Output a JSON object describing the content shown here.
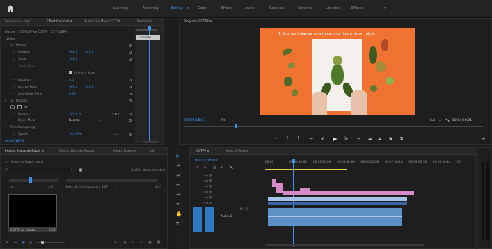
{
  "workspace_tabs": [
    "Learning",
    "Assembly",
    "Editing",
    "Color",
    "Effects",
    "Audio",
    "Graphics",
    "Libraries",
    "Libraries",
    "Effects"
  ],
  "workspace_active": "Editing",
  "source_panel": {
    "tabs": [
      "Source: (no clips)",
      "Effect Controls ≡",
      "Audio Clip Mixer: CCTPP",
      "Metadata"
    ],
    "active_tab": "Effect Controls ≡",
    "clip_label": "Master * CCTSUBPR ▸ CCTPP * CCTSUBPR",
    "section_video": "Video",
    "motion": "Motion",
    "position": "Position",
    "position_x": "960.0",
    "position_y": "540.0",
    "scale": "Scale",
    "scale_val": "100.0",
    "scale_width": "Scale Width",
    "uniform_scale": "Uniform Scale",
    "rotation": "Rotation",
    "rotation_val": "0.0",
    "anchor_point": "Anchor Point",
    "anchor_x": "960.0",
    "anchor_y": "540.0",
    "anti_flicker": "Anti-flicker Filter",
    "anti_flicker_val": "0.00",
    "opacity": "Opacity",
    "opacity_val": "100.0 %",
    "blend_mode": "Blend Mode",
    "blend_val": "Normal",
    "time_remapping": "Time Remapping",
    "speed": "Speed",
    "speed_val": "100.00%",
    "timecode": "00:00:18:01",
    "mini_clip": "CCTSUBPR"
  },
  "program_panel": {
    "title": "Program: CCTPP ≡",
    "video_caption": "1. Con las hojas se va a hacer una figura de un robot.",
    "timecode_left": "00;00;18;07",
    "fit": "Fit",
    "full": "Full",
    "timecode_right": "00;04;20;01"
  },
  "project_panel": {
    "tabs": [
      "Project: Hojas de Robot ≡",
      "Preset: Libro de Robots",
      "Media Browser",
      "Lib"
    ],
    "active_tab": "Project: Hojas de Robot ≡",
    "project_file": "Hojas de Robot.prproj",
    "item_count": "1 of 11 items selected",
    "stat_left": "4;27",
    "stat_mid": "Hojas de Configuración: 4;27",
    "stat_right": "4;27",
    "thumb_label": "CCTTP de Robots",
    "thumb_duration": "5:00"
  },
  "timeline_panel": {
    "tabs": [
      "CCTPP ≡",
      "Hojas de Robot"
    ],
    "active_tab": "CCTPP ≡",
    "timecode": "00;00;18;07",
    "ruler": [
      "00;00",
      "00;01;30;02",
      "00;03;00;04",
      "00;04;30;06",
      "00;06;00;08",
      "00;07;30;10",
      "00;09;00;12",
      "00;10;30;14",
      "00"
    ],
    "audio_label": "Audio 1",
    "playhead": 0.14
  }
}
